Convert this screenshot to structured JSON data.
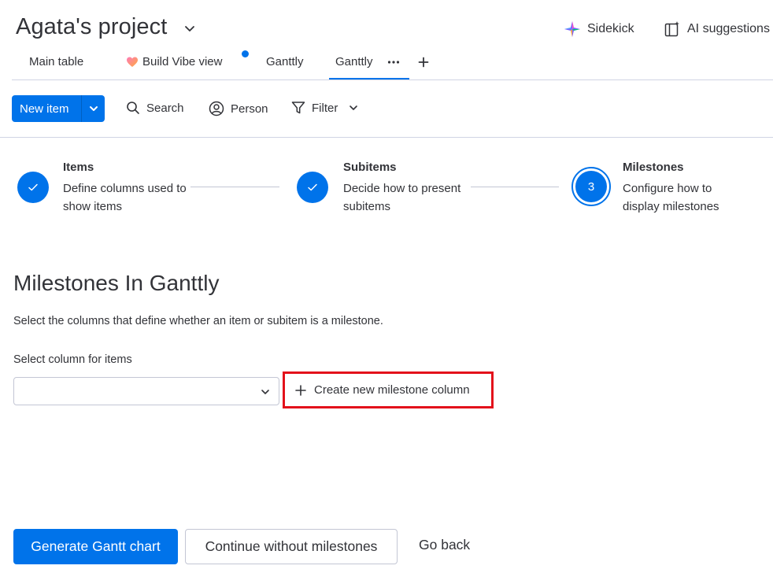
{
  "header": {
    "title": "Agata's project",
    "sidekick_label": "Sidekick",
    "ai_suggestions_label": "AI suggestions"
  },
  "tabs": [
    {
      "label": "Main table",
      "active": false
    },
    {
      "label": "Build Vibe view",
      "active": false
    },
    {
      "label": "Ganttly",
      "active": false
    },
    {
      "label": "Ganttly",
      "active": true
    }
  ],
  "toolbar": {
    "new_item_label": "New item",
    "search_label": "Search",
    "person_label": "Person",
    "filter_label": "Filter"
  },
  "stepper": {
    "steps": [
      {
        "title": "Items",
        "description": "Define columns used to show items",
        "status": "complete"
      },
      {
        "title": "Subitems",
        "description": "Decide how to present subitems",
        "status": "complete"
      },
      {
        "title": "Milestones",
        "description": "Configure how to display milestones",
        "status": "current",
        "number": "3"
      }
    ]
  },
  "content": {
    "heading": "Milestones In Ganttly",
    "subtext": "Select the columns that define whether an item or subitem is a milestone.",
    "field_label": "Select column for items",
    "select_value": "",
    "create_button_label": "Create new milestone column"
  },
  "actions": {
    "primary_label": "Generate Gantt chart",
    "secondary_label": "Continue without milestones",
    "tertiary_label": "Go back"
  },
  "colors": {
    "primary": "#0073ea",
    "highlight": "#e3111b",
    "text": "#323338",
    "border": "#c3c6d4"
  }
}
